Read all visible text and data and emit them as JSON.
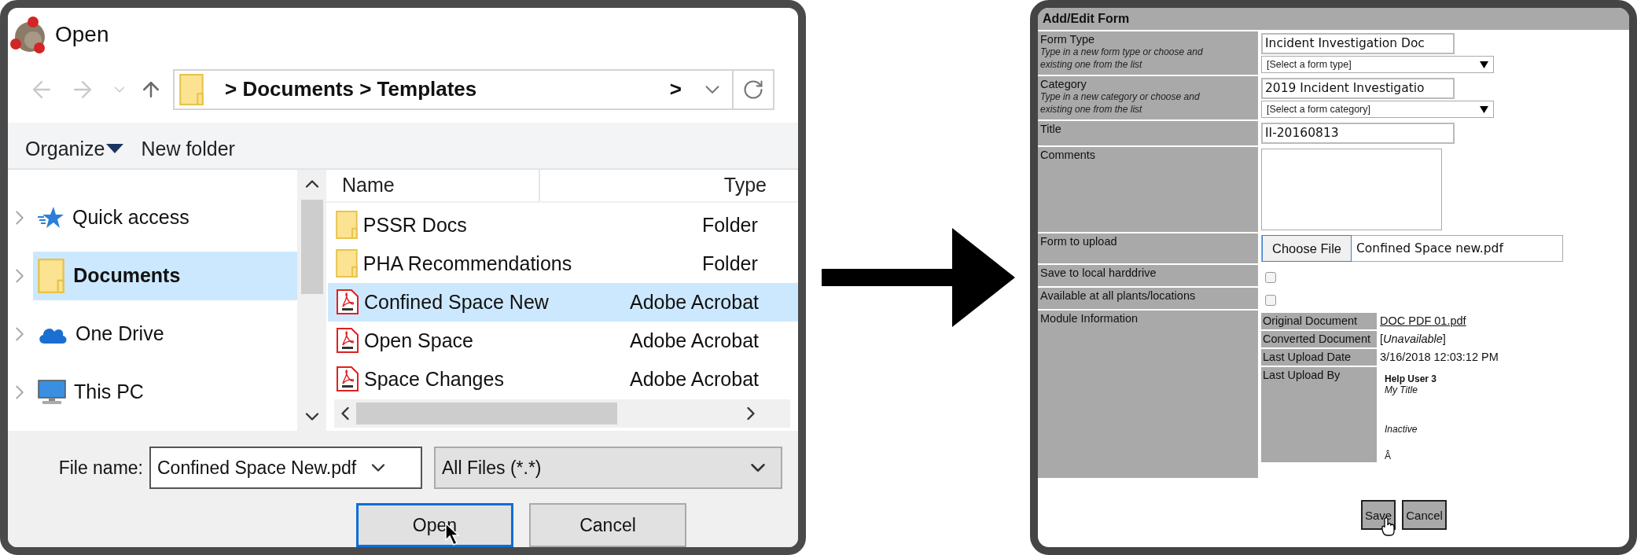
{
  "open_dialog": {
    "title": "Open",
    "address": {
      "path": "> Documents > Templates",
      "more": ">"
    },
    "toolbar": {
      "organize": "Organize",
      "new_folder": "New folder"
    },
    "nav_pane": {
      "items": [
        {
          "label": "Quick access",
          "kind": "star",
          "selected": false
        },
        {
          "label": "Documents",
          "kind": "folder",
          "selected": true
        },
        {
          "label": "One Drive",
          "kind": "cloud",
          "selected": false
        },
        {
          "label": "This PC",
          "kind": "pc",
          "selected": false
        }
      ]
    },
    "file_list": {
      "columns": [
        "Name",
        "Type"
      ],
      "rows": [
        {
          "name": "PSSR Docs",
          "type": "Folder",
          "kind": "folder",
          "selected": false
        },
        {
          "name": "PHA Recommendations",
          "type": "Folder",
          "kind": "folder",
          "selected": false
        },
        {
          "name": "Confined Space New",
          "type": "Adobe Acrobat",
          "kind": "pdf",
          "selected": true
        },
        {
          "name": "Open Space",
          "type": "Adobe Acrobat",
          "kind": "pdf",
          "selected": false
        },
        {
          "name": "Space Changes",
          "type": "Adobe Acrobat",
          "kind": "pdf",
          "selected": false
        }
      ]
    },
    "file_name": {
      "label": "File name:",
      "value": "Confined Space New.pdf"
    },
    "file_type": {
      "value": "All Files (*.*)"
    },
    "buttons": [
      {
        "label": "Open",
        "focused": true
      },
      {
        "label": "Cancel",
        "focused": false
      }
    ]
  },
  "form": {
    "title": "Add/Edit Form",
    "fields": [
      {
        "kind": "combo",
        "label": "Form Type",
        "hint": "Type in a new form type or choose and existing one from the list",
        "value": "Incident Investigation Doc",
        "select": "[Select a form type]"
      },
      {
        "kind": "combo",
        "label": "Category",
        "hint": "Type in a new category or choose and existing one from the list",
        "value": "2019 Incident Investigatio",
        "select": "[Select a form category]"
      },
      {
        "kind": "text",
        "label": "Title",
        "value": "II-20160813"
      },
      {
        "kind": "textarea",
        "label": "Comments"
      },
      {
        "kind": "file",
        "label": "Form to upload",
        "button": "Choose File",
        "file": "Confined Space new.pdf"
      },
      {
        "kind": "checkbox",
        "label": "Save to local harddrive",
        "checked": false
      },
      {
        "kind": "checkbox",
        "label": "Available at all plants/locations",
        "checked": false
      },
      {
        "kind": "module",
        "label": "Module Information",
        "rows": [
          {
            "kind": "link",
            "label": "Original Document",
            "value": "DOC PDF 01.pdf"
          },
          {
            "kind": "text",
            "label": "Converted Document",
            "value": "[*Unavailable*]"
          },
          {
            "kind": "text",
            "label": "Last Upload Date",
            "value": "3/16/2018 12:03:12 PM"
          },
          {
            "kind": "user",
            "label": "Last Upload By",
            "name": "Help User 3",
            "title": "My Title",
            "status": "Inactive",
            "extra": "Â"
          }
        ]
      }
    ],
    "buttons": [
      "Save",
      "Cancel"
    ]
  }
}
